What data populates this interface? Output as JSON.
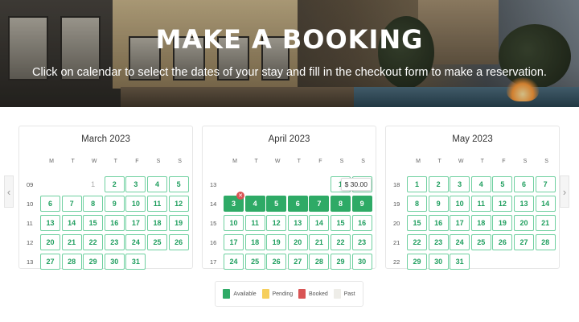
{
  "hero": {
    "title": "MAKE A BOOKING",
    "subtitle": "Click on calendar to select the dates of your stay and fill in the checkout form to make a reservation."
  },
  "nav": {
    "prev": "‹",
    "next": "›"
  },
  "dow": [
    "M",
    "T",
    "W",
    "T",
    "F",
    "S",
    "S"
  ],
  "colors": {
    "available": "#2eaa66",
    "pending": "#f6cf5c",
    "booked": "#d95454",
    "past": "#eeede8"
  },
  "months": [
    {
      "title": "March 2023",
      "weeks": [
        {
          "wk": "09",
          "days": [
            "",
            "",
            "1",
            "2",
            "3",
            "4",
            "5"
          ],
          "past_through": 2
        },
        {
          "wk": "10",
          "days": [
            "6",
            "7",
            "8",
            "9",
            "10",
            "11",
            "12"
          ]
        },
        {
          "wk": "11",
          "days": [
            "13",
            "14",
            "15",
            "16",
            "17",
            "18",
            "19"
          ]
        },
        {
          "wk": "12",
          "days": [
            "20",
            "21",
            "22",
            "23",
            "24",
            "25",
            "26"
          ]
        },
        {
          "wk": "13",
          "days": [
            "27",
            "28",
            "29",
            "30",
            "31",
            "",
            ""
          ]
        }
      ]
    },
    {
      "title": "April 2023",
      "weeks": [
        {
          "wk": "13",
          "days": [
            "",
            "",
            "",
            "",
            "",
            "1",
            "2"
          ]
        },
        {
          "wk": "14",
          "days": [
            "3",
            "4",
            "5",
            "6",
            "7",
            "8",
            "9"
          ],
          "selected": true
        },
        {
          "wk": "15",
          "days": [
            "10",
            "11",
            "12",
            "13",
            "14",
            "15",
            "16"
          ]
        },
        {
          "wk": "16",
          "days": [
            "17",
            "18",
            "19",
            "20",
            "21",
            "22",
            "23"
          ]
        },
        {
          "wk": "17",
          "days": [
            "24",
            "25",
            "26",
            "27",
            "28",
            "29",
            "30"
          ]
        }
      ],
      "tooltip": "$ 30.00",
      "booked_marker": "✕"
    },
    {
      "title": "May 2023",
      "weeks": [
        {
          "wk": "18",
          "days": [
            "1",
            "2",
            "3",
            "4",
            "5",
            "6",
            "7"
          ]
        },
        {
          "wk": "19",
          "days": [
            "8",
            "9",
            "10",
            "11",
            "12",
            "13",
            "14"
          ]
        },
        {
          "wk": "20",
          "days": [
            "15",
            "16",
            "17",
            "18",
            "19",
            "20",
            "21"
          ]
        },
        {
          "wk": "21",
          "days": [
            "22",
            "23",
            "24",
            "25",
            "26",
            "27",
            "28"
          ]
        },
        {
          "wk": "22",
          "days": [
            "29",
            "30",
            "31",
            "",
            "",
            "",
            ""
          ]
        }
      ]
    }
  ],
  "legend": [
    {
      "label": "Available",
      "color": "#2eaa66"
    },
    {
      "label": "Pending",
      "color": "#f6cf5c"
    },
    {
      "label": "Booked",
      "color": "#d95454"
    },
    {
      "label": "Past",
      "color": "#eeede8"
    }
  ]
}
